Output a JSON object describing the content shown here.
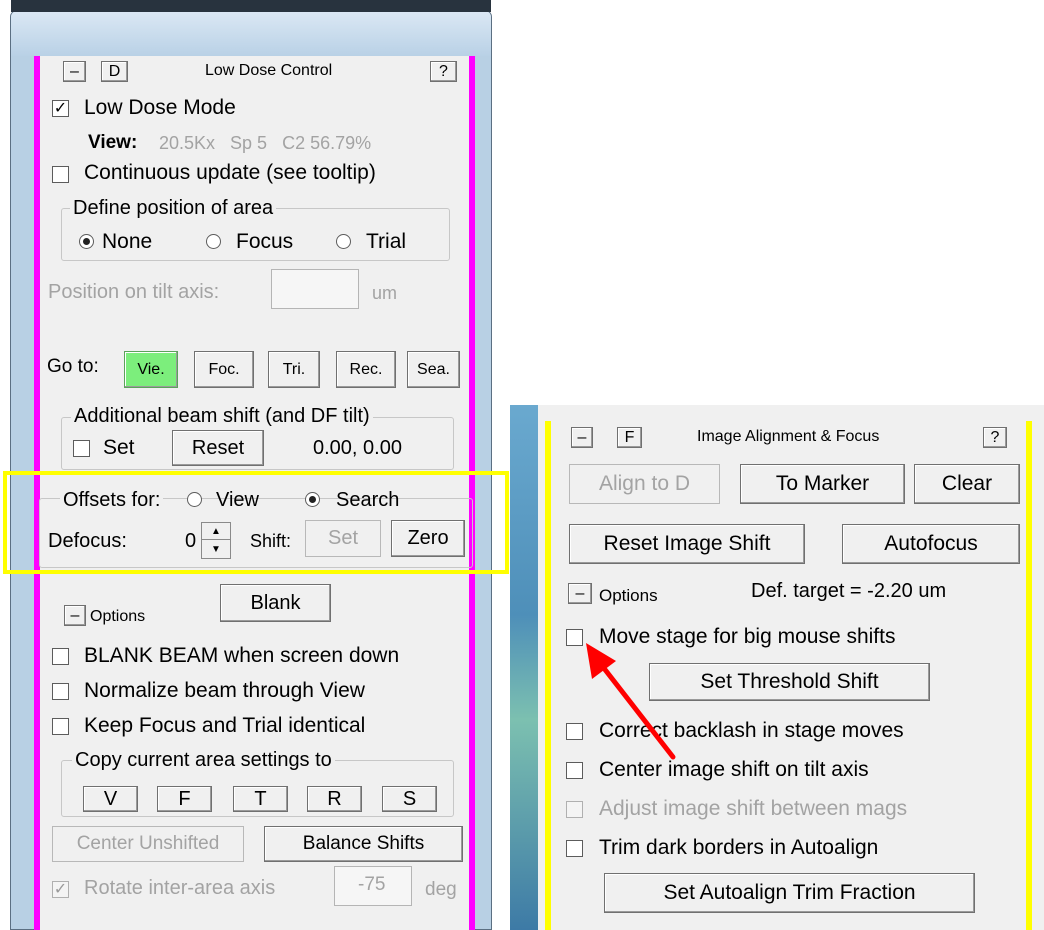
{
  "low_dose_panel": {
    "collapse_label": "–",
    "d_label": "D",
    "title": "Low Dose Control",
    "help_label": "?",
    "low_dose_mode_label": "Low Dose Mode",
    "low_dose_mode_checked": "✓",
    "view_label": "View:",
    "view_info": "20.5Kx   Sp 5   C2 56.79%",
    "continuous_update_label": "Continuous update (see tooltip)",
    "define_position_legend": "Define position of area",
    "radio_none": "None",
    "radio_focus": "Focus",
    "radio_trial": "Trial",
    "position_tilt_label": "Position on tilt axis:",
    "position_tilt_unit": "um",
    "goto_label": "Go to:",
    "goto_buttons": [
      "Vie.",
      "Foc.",
      "Tri.",
      "Rec.",
      "Sea."
    ],
    "beam_shift_legend": "Additional beam shift (and DF tilt)",
    "set_label": "Set",
    "reset_label": "Reset",
    "beam_shift_value": "0.00, 0.00",
    "offsets_legend": "Offsets for:",
    "offsets_view": "View",
    "offsets_search": "Search",
    "defocus_label": "Defocus:",
    "defocus_value": "0",
    "shift_label": "Shift:",
    "shift_set_label": "Set",
    "zero_label": "Zero",
    "options_collapse": "–",
    "options_label": "Options",
    "blank_label": "Blank",
    "blank_beam_label": "BLANK BEAM when screen down",
    "normalize_label": "Normalize beam through View",
    "keep_focus_label": "Keep Focus and Trial identical",
    "copy_legend": "Copy current area settings to",
    "copy_buttons": [
      "V",
      "F",
      "T",
      "R",
      "S"
    ],
    "center_unshifted_label": "Center Unshifted",
    "balance_shifts_label": "Balance Shifts",
    "rotate_label": "Rotate inter-area axis",
    "rotate_checked": "✓",
    "rotate_value": "-75",
    "rotate_unit": "deg"
  },
  "align_panel": {
    "collapse_label": "–",
    "f_label": "F",
    "title": "Image Alignment & Focus",
    "help_label": "?",
    "align_to_d_label": "Align to D",
    "to_marker_label": "To Marker",
    "clear_label": "Clear",
    "reset_image_shift_label": "Reset Image Shift",
    "autofocus_label": "Autofocus",
    "options_collapse": "–",
    "options_label": "Options",
    "def_target_label": "Def. target = -2.20 um",
    "move_stage_label": "Move stage for big mouse shifts",
    "set_threshold_label": "Set Threshold Shift",
    "correct_backlash_label": "Correct backlash in stage moves",
    "center_image_shift_label": "Center image shift on tilt axis",
    "adjust_image_shift_label": "Adjust image shift between mags",
    "trim_borders_label": "Trim dark borders in Autoalign",
    "set_trim_label": "Set Autoalign Trim Fraction"
  },
  "colors": {
    "magenta_bar": "#ff00ff",
    "yellow_bar": "#ffff00",
    "highlight_box": "#ffff00",
    "arrow": "#ff0000",
    "go_to_active": "#7cee7c"
  }
}
